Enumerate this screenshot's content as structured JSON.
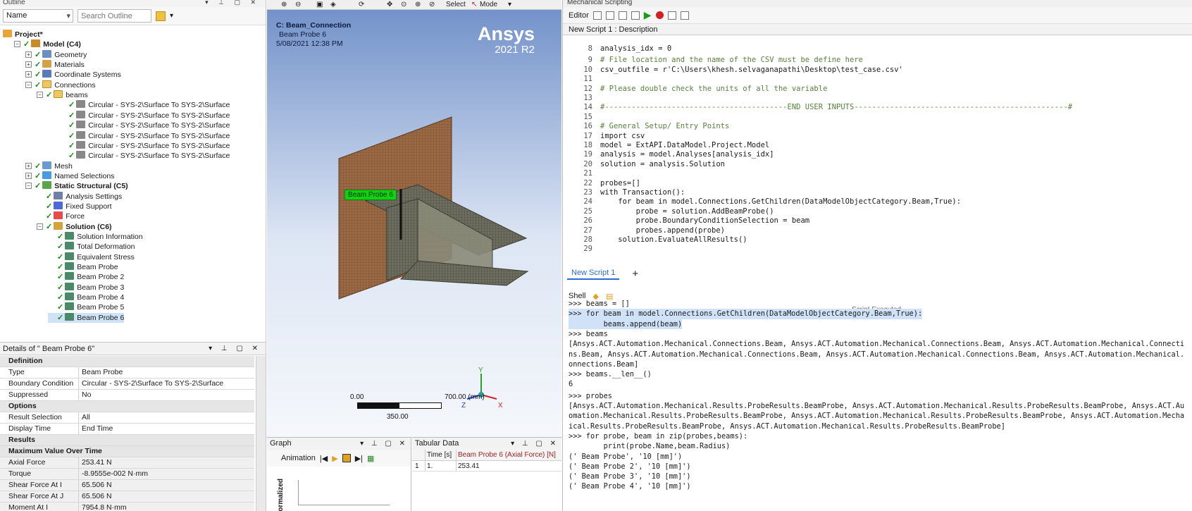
{
  "outline": {
    "title": "Outline",
    "filter_select": "Name",
    "search_placeholder": "Search Outline",
    "items": [
      {
        "label": "Project*"
      },
      {
        "label": "Model (C4)"
      },
      {
        "label": "Geometry"
      },
      {
        "label": "Materials"
      },
      {
        "label": "Coordinate Systems"
      },
      {
        "label": "Connections"
      },
      {
        "label": "beams"
      },
      {
        "label": "Circular - SYS-2\\Surface To SYS-2\\Surface"
      },
      {
        "label": "Circular - SYS-2\\Surface To SYS-2\\Surface"
      },
      {
        "label": "Circular - SYS-2\\Surface To SYS-2\\Surface"
      },
      {
        "label": "Circular - SYS-2\\Surface To SYS-2\\Surface"
      },
      {
        "label": "Circular - SYS-2\\Surface To SYS-2\\Surface"
      },
      {
        "label": "Circular - SYS-2\\Surface To SYS-2\\Surface"
      },
      {
        "label": "Mesh"
      },
      {
        "label": "Named Selections"
      },
      {
        "label": "Static Structural (C5)"
      },
      {
        "label": "Analysis Settings"
      },
      {
        "label": "Fixed Support"
      },
      {
        "label": "Force"
      },
      {
        "label": "Solution (C6)"
      },
      {
        "label": "Solution Information"
      },
      {
        "label": "Total Deformation"
      },
      {
        "label": "Equivalent Stress"
      },
      {
        "label": "Beam Probe"
      },
      {
        "label": "Beam Probe 2"
      },
      {
        "label": "Beam Probe 3"
      },
      {
        "label": "Beam Probe 4"
      },
      {
        "label": "Beam Probe 5"
      },
      {
        "label": "Beam Probe 6"
      }
    ]
  },
  "details": {
    "title": "Details of \" Beam Probe 6\"",
    "rows": [
      {
        "k": "Definition",
        "v": "",
        "section": true
      },
      {
        "k": "Type",
        "v": "Beam Probe"
      },
      {
        "k": "Boundary Condition",
        "v": "Circular - SYS-2\\Surface To SYS-2\\Surface"
      },
      {
        "k": "Suppressed",
        "v": "No"
      },
      {
        "k": "Options",
        "v": "",
        "section": true
      },
      {
        "k": "Result Selection",
        "v": "All"
      },
      {
        "k": "Display Time",
        "v": "End Time"
      },
      {
        "k": "Results",
        "v": "",
        "section": true
      },
      {
        "k": "Maximum Value Over Time",
        "v": "",
        "section": true
      },
      {
        "k": "Axial Force",
        "v": "253.41 N"
      },
      {
        "k": "Torque",
        "v": "-8.9555e-002 N·mm"
      },
      {
        "k": "Shear Force At I",
        "v": "65.506 N"
      },
      {
        "k": "Shear Force At J",
        "v": "65.506 N"
      },
      {
        "k": "Moment At I",
        "v": "7954.8 N·mm"
      }
    ]
  },
  "viewport": {
    "toolbar_select": "Select",
    "toolbar_mode": "Mode",
    "title_line1": "C: Beam_Connection",
    "title_line2": "Beam Probe 6",
    "title_line3": "5/08/2021 12:38 PM",
    "brand": "Ansys",
    "version": "2021 R2",
    "probe_label": "Beam Probe 6",
    "scale_min": "0.00",
    "scale_max": "700.00 (mm)",
    "scale_mid": "350.00",
    "axis_x": "X",
    "axis_y": "Y",
    "axis_z": "Z"
  },
  "graph": {
    "title": "Graph",
    "animation_label": "Animation",
    "ylabel": "Normalized"
  },
  "tabular": {
    "title": "Tabular Data",
    "col_time": "Time [s]",
    "col_series": "Beam Probe 6 (Axial Force) [N]",
    "row_index": "1",
    "row_time": "1.",
    "row_value": "253.41"
  },
  "scripting": {
    "title": "Mechanical Scripting",
    "editor_label": "Editor",
    "description": "New Script 1 : Description",
    "tab": "New Script 1",
    "add_tab": "+",
    "shell_label": "Shell",
    "script_executed": "Script Executed",
    "code_lines": [
      {
        "n": "8",
        "t": "analysis_idx = 0"
      },
      {
        "n": "9",
        "t": "# File location and the name of the CSV must be define here"
      },
      {
        "n": "10",
        "t": "csv_outfile = r'C:\\Users\\khesh.selvaganapathi\\Desktop\\test_case.csv'"
      },
      {
        "n": "11",
        "t": ""
      },
      {
        "n": "12",
        "t": "# Please double check the units of all the variable"
      },
      {
        "n": "13",
        "t": ""
      },
      {
        "n": "14",
        "t": "#-----------------------------------------END USER INPUTS------------------------------------------------#"
      },
      {
        "n": "15",
        "t": ""
      },
      {
        "n": "16",
        "t": "# General Setup/ Entry Points"
      },
      {
        "n": "17",
        "t": "import csv"
      },
      {
        "n": "18",
        "t": "model = ExtAPI.DataModel.Project.Model"
      },
      {
        "n": "19",
        "t": "analysis = model.Analyses[analysis_idx]"
      },
      {
        "n": "20",
        "t": "solution = analysis.Solution"
      },
      {
        "n": "21",
        "t": ""
      },
      {
        "n": "22",
        "t": "probes=[]"
      },
      {
        "n": "23",
        "t": "with Transaction():"
      },
      {
        "n": "24",
        "t": "    for beam in model.Connections.GetChildren(DataModelObjectCategory.Beam,True):"
      },
      {
        "n": "25",
        "t": "        probe = solution.AddBeamProbe()"
      },
      {
        "n": "26",
        "t": "        probe.BoundaryConditionSelection = beam"
      },
      {
        "n": "27",
        "t": "        probes.append(probe)"
      },
      {
        "n": "28",
        "t": "    solution.EvaluateAllResults()"
      },
      {
        "n": "29",
        "t": ""
      }
    ],
    "shell_lines": [
      ">>> beams = []",
      ">>> for beam in model.Connections.GetChildren(DataModelObjectCategory.Beam,True):",
      "        beams.append(beam)",
      ">>> beams",
      "[Ansys.ACT.Automation.Mechanical.Connections.Beam, Ansys.ACT.Automation.Mechanical.Connections.Beam, Ansys.ACT.Automation.Mechanical.Connecti",
      "ns.Beam, Ansys.ACT.Automation.Mechanical.Connections.Beam, Ansys.ACT.Automation.Mechanical.Connections.Beam, Ansys.ACT.Automation.Mechanical.",
      "onnections.Beam]",
      ">>> beams.__len__()",
      "6",
      ">>> probes",
      "[Ansys.ACT.Automation.Mechanical.Results.ProbeResults.BeamProbe, Ansys.ACT.Automation.Mechanical.Results.ProbeResults.BeamProbe, Ansys.ACT.Au",
      "omation.Mechanical.Results.ProbeResults.BeamProbe, Ansys.ACT.Automation.Mechanical.Results.ProbeResults.BeamProbe, Ansys.ACT.Automation.Mecha",
      "ical.Results.ProbeResults.BeamProbe, Ansys.ACT.Automation.Mechanical.Results.ProbeResults.BeamProbe]",
      ">>> for probe, beam in zip(probes,beams):",
      "        print(probe.Name,beam.Radius)",
      "(' Beam Probe', '10 [mm]')",
      "(' Beam Probe 2', '10 [mm]')",
      "(' Beam Probe 3', '10 [mm]')",
      "(' Beam Probe 4', '10 [mm]')"
    ]
  }
}
